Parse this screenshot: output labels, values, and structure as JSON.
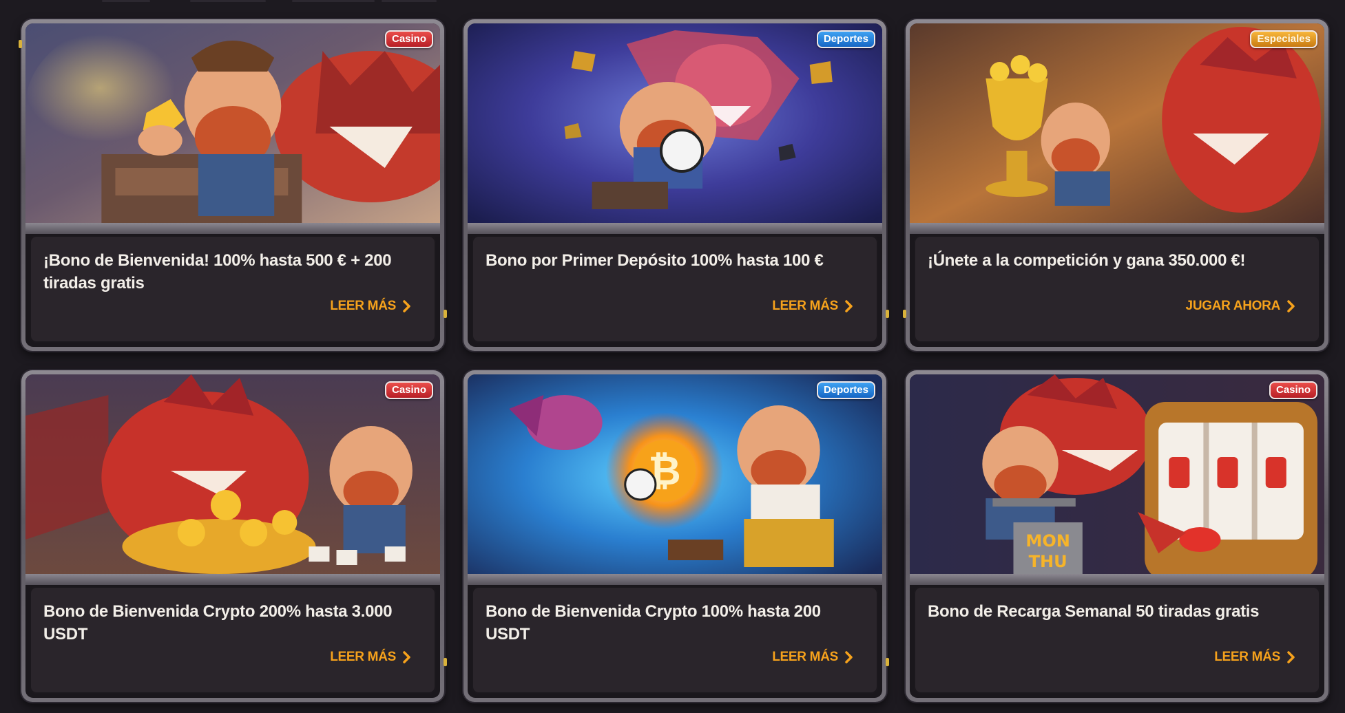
{
  "cards": [
    {
      "title": "¡Bono de Bienvenida! 100% hasta 500 € + 200 tiradas gratis",
      "cta": "LEER MÁS",
      "badge": "Casino",
      "badge_color": "#d8333a",
      "art": "miner-gold-dragon"
    },
    {
      "title": "Bono por Primer Depósito 100% hasta 100 €",
      "cta": "LEER MÁS",
      "badge": "Deportes",
      "badge_color": "#2a86dc",
      "art": "miner-soccer-dragon"
    },
    {
      "title": "¡Únete a la competición y gana 350.000 €!",
      "cta": "JUGAR AHORA",
      "badge": "Especiales",
      "badge_color": "#e69a24",
      "art": "miner-trophy-dragon"
    },
    {
      "title": "Bono de Bienvenida Crypto 200% hasta 3.000 USDT",
      "cta": "LEER MÁS",
      "badge": "Casino",
      "badge_color": "#d8333a",
      "art": "dragon-bitcoin-coins"
    },
    {
      "title": "Bono de Bienvenida Crypto 100% hasta 200 USDT",
      "cta": "LEER MÁS",
      "badge": "Deportes",
      "badge_color": "#2a86dc",
      "art": "miner-fire-ball-bitcoin"
    },
    {
      "title": "Bono de Recarga Semanal 50 tiradas gratis",
      "cta": "LEER MÁS",
      "badge": "Casino",
      "badge_color": "#d8333a",
      "art": "miner-slot-machine",
      "art_text": "MON THU"
    }
  ],
  "icons": {
    "cta_arrow": "chevron-right-icon"
  },
  "colors": {
    "background": "#1d1a20",
    "cta_text": "#f6a21c",
    "title_text": "#f2eee8",
    "card_panel": "#2a252b"
  }
}
